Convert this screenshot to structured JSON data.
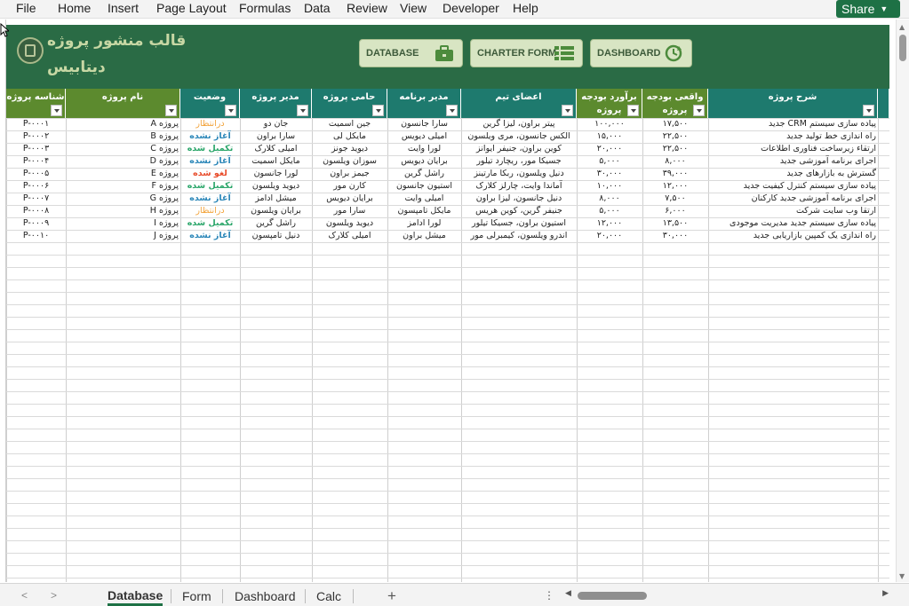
{
  "menu": [
    "File",
    "Home",
    "Insert",
    "Page Layout",
    "Formulas",
    "Data",
    "Review",
    "View",
    "Developer",
    "Help"
  ],
  "share": {
    "label": "Share"
  },
  "banner": {
    "title_line1": "قالب منشور پروژه",
    "title_line2": "دیتابیس",
    "buttons": {
      "database": "DATABASE",
      "charter": "CHARTER FORM",
      "dashboard": "DASHBOARD"
    },
    "colors": {
      "banner": "#2a6b45",
      "title": "#c7d7a4",
      "button": "#d8e5c3"
    }
  },
  "table": {
    "headers": [
      {
        "id": "code",
        "label": "شناسه پروژه"
      },
      {
        "id": "name",
        "label": "نام پروژه"
      },
      {
        "id": "status",
        "label": "وضعیت"
      },
      {
        "id": "manager",
        "label": "مدیر پروژه"
      },
      {
        "id": "sponsor",
        "label": "حامی پروژه"
      },
      {
        "id": "program",
        "label": "مدیر برنامه"
      },
      {
        "id": "team",
        "label": "اعضای تیم"
      },
      {
        "id": "budget_est",
        "label": "برآورد بودجه پروژه"
      },
      {
        "id": "budget_act",
        "label": "واقعی بودجه پروژه"
      },
      {
        "id": "desc",
        "label": "شرح پروژه"
      }
    ],
    "rows": [
      {
        "code": "P-۰۰۰۱",
        "name": "پروژه A",
        "status": "درانتظار",
        "st": "orange",
        "manager": "جان دو",
        "sponsor": "جین اسمیت",
        "program": "سارا جانسون",
        "team": "پیتر براون، لیزا گرین",
        "budget_est": "۱۰۰,۰۰۰",
        "budget_act": "۱۷,۵۰۰",
        "desc": "پیاده سازی سیستم CRM جدید"
      },
      {
        "code": "P-۰۰۰۲",
        "name": "پروژه B",
        "status": "آغاز نشده",
        "st": "blue",
        "manager": "سارا براون",
        "sponsor": "مایکل لی",
        "program": "امیلی دیویس",
        "team": "الکس جانسون، مری ویلسون",
        "budget_est": "۱۵,۰۰۰",
        "budget_act": "۲۲,۵۰۰",
        "desc": "راه اندازی خط تولید جدید"
      },
      {
        "code": "P-۰۰۰۳",
        "name": "پروژه C",
        "status": "تکمیل شده",
        "st": "green",
        "manager": "امیلی کلارک",
        "sponsor": "دیوید جونز",
        "program": "لورا وایت",
        "team": "کوین براون، جنیفر ایوانز",
        "budget_est": "۲۰,۰۰۰",
        "budget_act": "۲۲,۵۰۰",
        "desc": "ارتقاء زیرساخت فناوری اطلاعات"
      },
      {
        "code": "P-۰۰۰۴",
        "name": "پروژه D",
        "status": "آغاز نشده",
        "st": "blue",
        "manager": "مایکل اسمیت",
        "sponsor": "سوزان ویلسون",
        "program": "برایان دیویس",
        "team": "جسیکا مور، ریچارد تیلور",
        "budget_est": "۵,۰۰۰",
        "budget_act": "۸,۰۰۰",
        "desc": "اجرای برنامه آموزشی جدید"
      },
      {
        "code": "P-۰۰۰۵",
        "name": "پروژه E",
        "status": "لغو شده",
        "st": "red",
        "manager": "لورا جانسون",
        "sponsor": "جیمز براون",
        "program": "راشل گرین",
        "team": "دنیل ویلسون، ربکا مارتینز",
        "budget_est": "۳۰,۰۰۰",
        "budget_act": "۳۹,۰۰۰",
        "desc": "گسترش به بازارهای جدید"
      },
      {
        "code": "P-۰۰۰۶",
        "name": "پروژه F",
        "status": "تکمیل شده",
        "st": "green",
        "manager": "دیوید ویلسون",
        "sponsor": "کارن مور",
        "program": "استیون جانسون",
        "team": "آماندا وایت، چارلز کلارک",
        "budget_est": "۱۰,۰۰۰",
        "budget_act": "۱۲,۰۰۰",
        "desc": "پیاده سازی سیستم کنترل کیفیت جدید"
      },
      {
        "code": "P-۰۰۰۷",
        "name": "پروژه G",
        "status": "آغاز نشده",
        "st": "blue",
        "manager": "میشل ادامز",
        "sponsor": "برایان دیویس",
        "program": "امیلی وایت",
        "team": "دنیل جانسون، لیزا براون",
        "budget_est": "۸,۰۰۰",
        "budget_act": "۷,۵۰۰",
        "desc": "اجرای برنامه آموزشی جدید کارکنان"
      },
      {
        "code": "P-۰۰۰۸",
        "name": "پروژه H",
        "status": "درانتظار",
        "st": "orange",
        "manager": "برایان ویلسون",
        "sponsor": "سارا مور",
        "program": "مایکل تامپسون",
        "team": "جنیفر گرین، کوین هریس",
        "budget_est": "۵,۰۰۰",
        "budget_act": "۶,۰۰۰",
        "desc": "ارتقا وب سایت شرکت"
      },
      {
        "code": "P-۰۰۰۹",
        "name": "پروژه I",
        "status": "تکمیل شده",
        "st": "green",
        "manager": "راشل گرین",
        "sponsor": "دیوید ویلسون",
        "program": "لورا ادامز",
        "team": "استیون براون، جسیکا تیلور",
        "budget_est": "۱۲,۰۰۰",
        "budget_act": "۱۳,۵۰۰",
        "desc": "پیاده سازی سیستم جدید مدیریت موجودی"
      },
      {
        "code": "P-۰۰۱۰",
        "name": "پروژه J",
        "status": "آغاز نشده",
        "st": "blue",
        "manager": "دنیل تامپسون",
        "sponsor": "امیلی کلارک",
        "program": "میشل براون",
        "team": "اندرو ویلسون، کیمبرلی مور",
        "budget_est": "۲۰,۰۰۰",
        "budget_act": "۳۰,۰۰۰",
        "desc": "راه اندازی یک کمپین بازاریابی جدید"
      }
    ],
    "colors": {
      "header": "#1e7a6e",
      "header_alt": "#5c8a2e",
      "completed": "#2ba66a",
      "not_started": "#2a86b8",
      "pending": "#f2a33a",
      "cancelled": "#e84c2b"
    }
  },
  "sheet_tabs": [
    {
      "label": "Database",
      "active": true
    },
    {
      "label": "Form",
      "active": false
    },
    {
      "label": "Dashboard",
      "active": false
    },
    {
      "label": "Calc",
      "active": false
    }
  ],
  "icons": [
    "share-chevron-icon",
    "logo-icon",
    "briefcase-icon",
    "list-icon",
    "refresh-icon",
    "filter-dropdown-icon",
    "add-sheet-icon",
    "scroll-left-icon",
    "scroll-right-icon",
    "more-options-icon",
    "mouse-cursor-icon"
  ]
}
